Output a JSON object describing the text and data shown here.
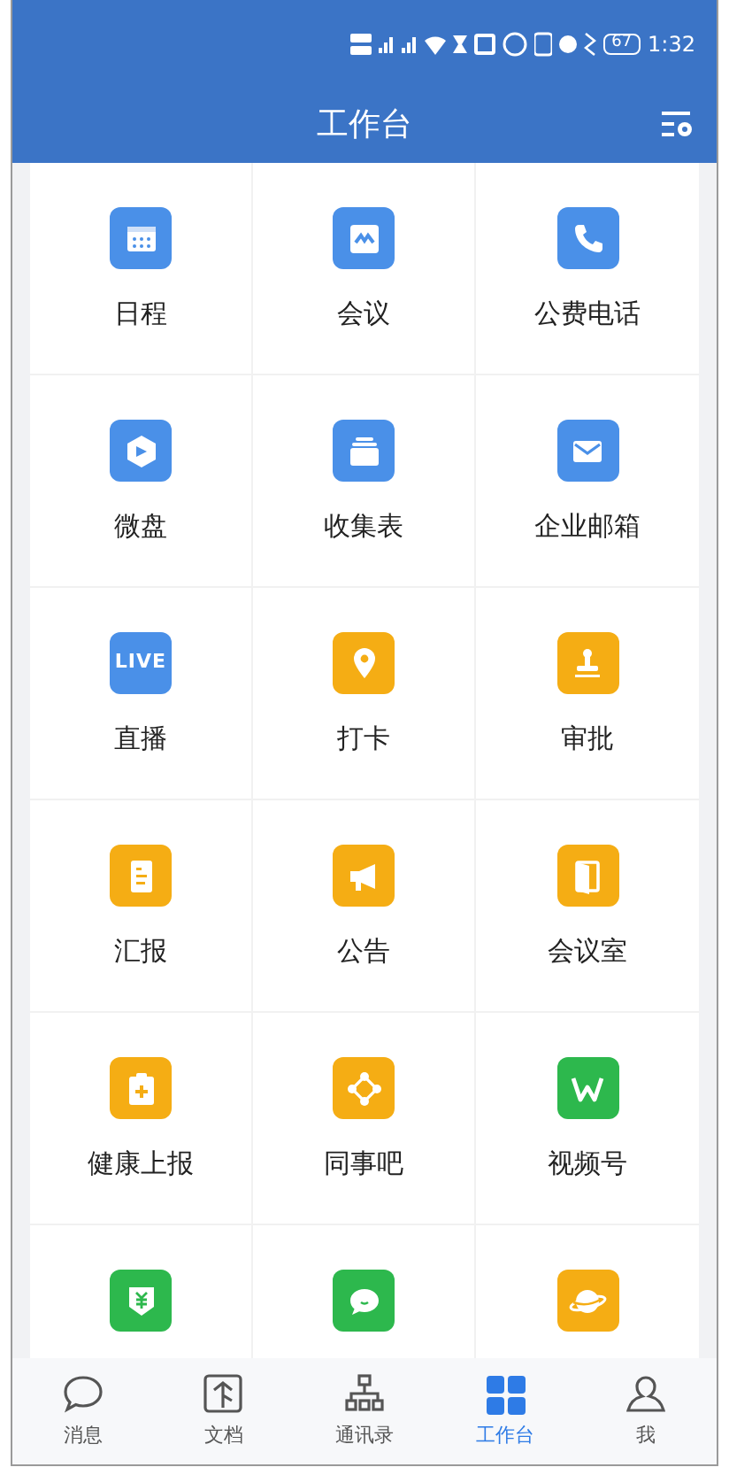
{
  "status_bar": {
    "battery": "67",
    "time": "1:32"
  },
  "header": {
    "title": "工作台"
  },
  "apps": [
    {
      "label": "日程",
      "color": "#4a90e8"
    },
    {
      "label": "会议",
      "color": "#4a90e8"
    },
    {
      "label": "公费电话",
      "color": "#4a90e8"
    },
    {
      "label": "微盘",
      "color": "#4a90e8"
    },
    {
      "label": "收集表",
      "color": "#4a90e8"
    },
    {
      "label": "企业邮箱",
      "color": "#4a90e8"
    },
    {
      "label": "直播",
      "icon_text": "LIVE",
      "color": "#4a90e8"
    },
    {
      "label": "打卡",
      "color": "#f5ad14"
    },
    {
      "label": "审批",
      "color": "#f5ad14"
    },
    {
      "label": "汇报",
      "color": "#f5ad14"
    },
    {
      "label": "公告",
      "color": "#f5ad14"
    },
    {
      "label": "会议室",
      "color": "#f5ad14"
    },
    {
      "label": "健康上报",
      "color": "#f5ad14"
    },
    {
      "label": "同事吧",
      "color": "#f5ad14"
    },
    {
      "label": "视频号",
      "color": "#2db84d"
    },
    {
      "color": "#2db84d"
    },
    {
      "color": "#2db84d"
    },
    {
      "color": "#f5ad14"
    }
  ],
  "tabs": [
    {
      "label": "消息",
      "selected": false
    },
    {
      "label": "文档",
      "selected": false
    },
    {
      "label": "通讯录",
      "selected": false
    },
    {
      "label": "工作台",
      "selected": true
    },
    {
      "label": "我",
      "selected": false
    }
  ]
}
